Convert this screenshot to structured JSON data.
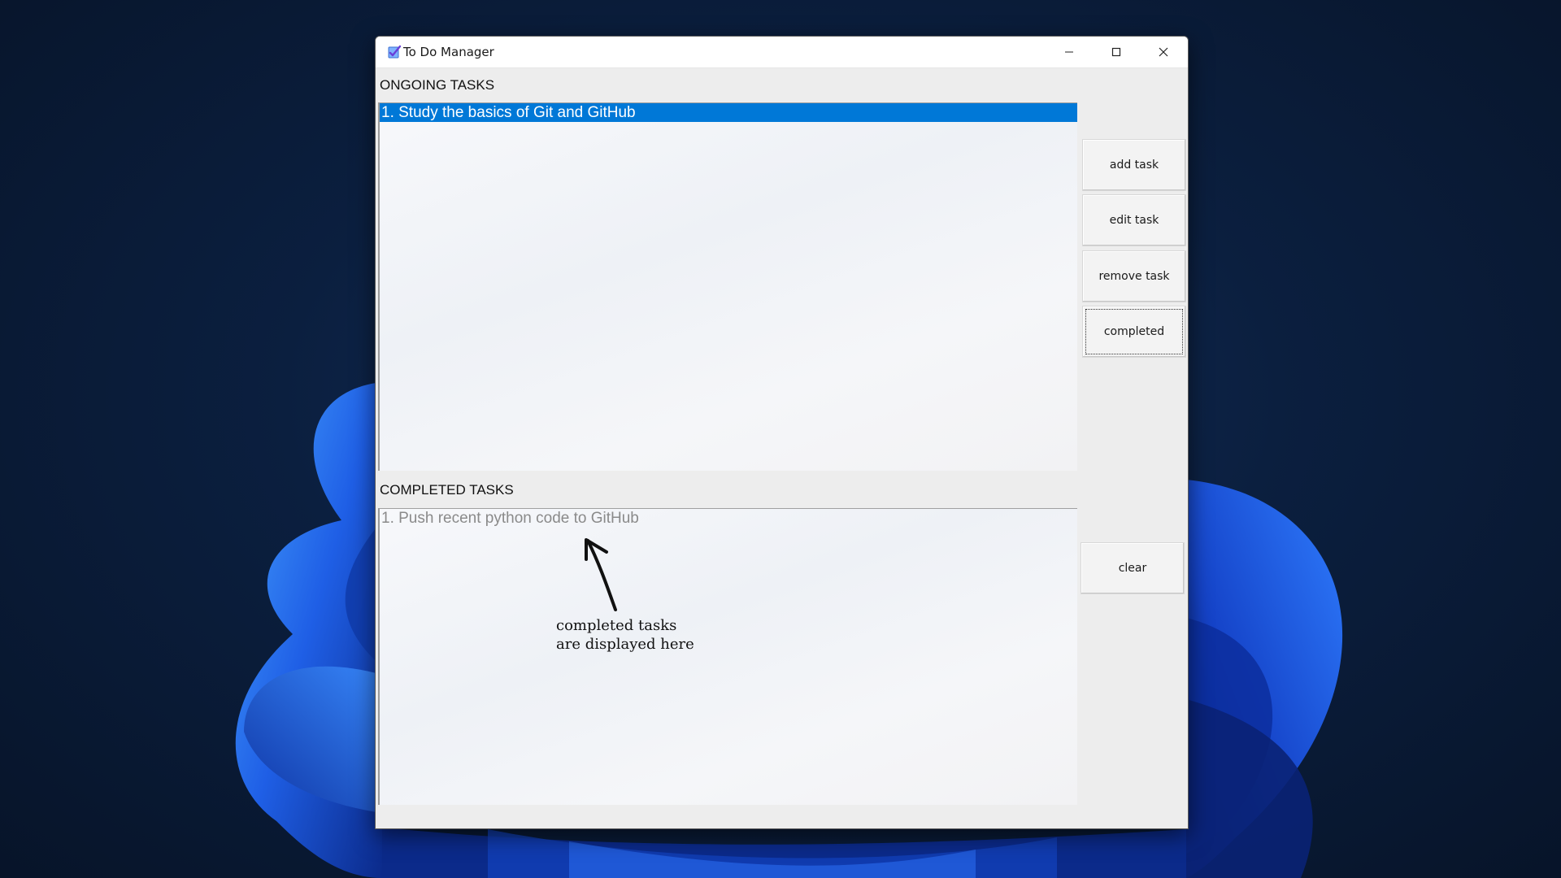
{
  "window": {
    "title": "To Do Manager",
    "icon": "checkmark-notepad-icon"
  },
  "ongoing": {
    "label": "ONGOING TASKS",
    "items": [
      "1. Study the basics of Git and GitHub"
    ],
    "selected_index": 0
  },
  "completed": {
    "label": "COMPLETED TASKS",
    "items": [
      "1. Push recent python code to GitHub"
    ]
  },
  "buttons": {
    "add": "add task",
    "edit": "edit task",
    "remove": "remove task",
    "completed": "completed",
    "clear": "clear"
  },
  "annotation": {
    "line1": "completed tasks",
    "line2": "are displayed here"
  },
  "colors": {
    "selection": "#0078d7",
    "completed_text": "#8a8a8a",
    "wallpaper_bloom": "#1e5fe0"
  }
}
